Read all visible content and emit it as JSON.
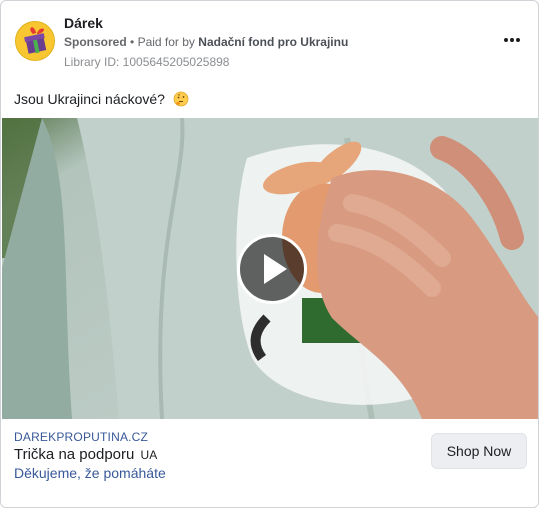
{
  "ad": {
    "page_name": "Dárek",
    "sponsored_label": "Sponsored",
    "separator": "•",
    "paid_for_by_label": "Paid for by",
    "funder": "Nadační fond pro Ukrajinu",
    "library_id": "Library ID: 1005645205025898",
    "text": "Jsou Ukrajinci náckové?",
    "emoji_icon": "thinking-face-icon"
  },
  "link_card": {
    "domain": "DAREKPROPUTINA.CZ",
    "headline": "Trička na podporu",
    "headline_suffix": "UA",
    "description": "Děkujeme, že pomáháte",
    "cta_label": "Shop Now"
  },
  "colors": {
    "link_blue": "#385898",
    "meta_gray": "#65676b",
    "avatar_yellow": "#f7c630",
    "cta_bg": "#eceef1"
  }
}
